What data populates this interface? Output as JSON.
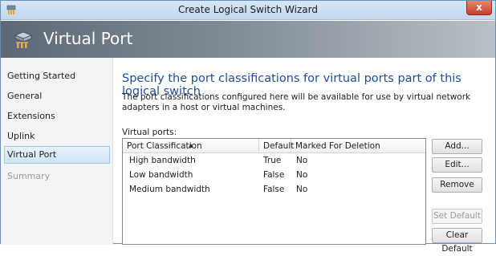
{
  "window": {
    "title": "Create Logical Switch Wizard",
    "close_glyph": "x"
  },
  "banner": {
    "title": "Virtual Port",
    "icon": "switch-icon"
  },
  "nav": {
    "items": [
      {
        "label": "Getting Started",
        "state": "normal"
      },
      {
        "label": "General",
        "state": "normal"
      },
      {
        "label": "Extensions",
        "state": "normal"
      },
      {
        "label": "Uplink",
        "state": "normal"
      },
      {
        "label": "Virtual Port",
        "state": "selected"
      },
      {
        "label": "Summary",
        "state": "disabled"
      }
    ]
  },
  "main": {
    "heading": "Specify the port classifications for virtual ports part of this logical switch",
    "description": "The port classifications configured here will be available for use by virtual network adapters in a host or virtual machines.",
    "list_label": "Virtual ports:",
    "columns": [
      "Port Classification",
      "Default",
      "Marked For Deletion"
    ],
    "rows": [
      [
        "High bandwidth",
        "True",
        "No"
      ],
      [
        "Low bandwidth",
        "False",
        "No"
      ],
      [
        "Medium bandwidth",
        "False",
        "No"
      ]
    ]
  },
  "buttons": {
    "add": "Add...",
    "edit": "Edit...",
    "remove": "Remove",
    "set_default": "Set Default",
    "clear_default": "Clear Default"
  },
  "colors": {
    "heading": "#1f4e96",
    "selected_nav": "#cfe4f8",
    "close_button": "#c7402a"
  }
}
